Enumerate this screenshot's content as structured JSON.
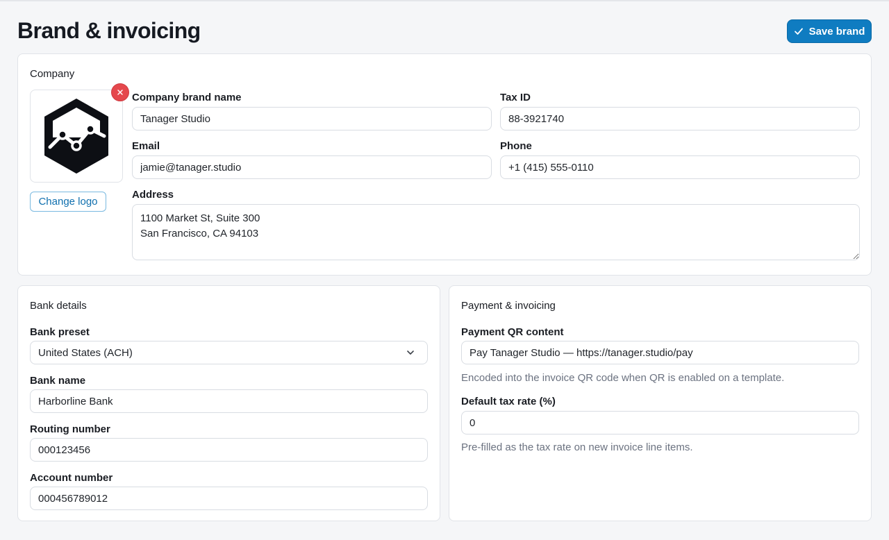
{
  "page": {
    "title": "Brand & invoicing"
  },
  "toolbar": {
    "save_label": "Save brand"
  },
  "company": {
    "section_title": "Company",
    "change_logo_label": "Change logo",
    "fields": {
      "brand_name": {
        "label": "Company brand name",
        "value": "Tanager Studio"
      },
      "tax_id": {
        "label": "Tax ID",
        "value": "88-3921740"
      },
      "email": {
        "label": "Email",
        "value": "jamie@tanager.studio"
      },
      "phone": {
        "label": "Phone",
        "value": "+1 (415) 555-0110"
      },
      "address": {
        "label": "Address",
        "value": "1100 Market St, Suite 300\nSan Francisco, CA 94103"
      }
    }
  },
  "bank": {
    "section_title": "Bank details",
    "preset": {
      "label": "Bank preset",
      "value": "United States (ACH)"
    },
    "bank_name": {
      "label": "Bank name",
      "value": "Harborline Bank"
    },
    "routing_number": {
      "label": "Routing number",
      "value": "000123456"
    },
    "account_number": {
      "label": "Account number",
      "value": "000456789012"
    }
  },
  "payment": {
    "section_title": "Payment & invoicing",
    "qr_content": {
      "label": "Payment QR content",
      "value": "Pay Tanager Studio — https://tanager.studio/pay",
      "help": "Encoded into the invoice QR code when QR is enabled on a template."
    },
    "tax_rate": {
      "label": "Default tax rate (%)",
      "value": "0",
      "help": "Pre-filled as the tax rate on new invoice line items."
    }
  },
  "icons": {
    "save": "check-icon",
    "remove_logo": "close-icon",
    "preset_dropdown": "chevron-down-icon",
    "logo": "hexagon-chart-logo"
  },
  "colors": {
    "accent": "#0f7cc1",
    "danger": "#e5484d",
    "background": "#f5f6f8",
    "card": "#ffffff",
    "border": "#e0e3e8"
  }
}
